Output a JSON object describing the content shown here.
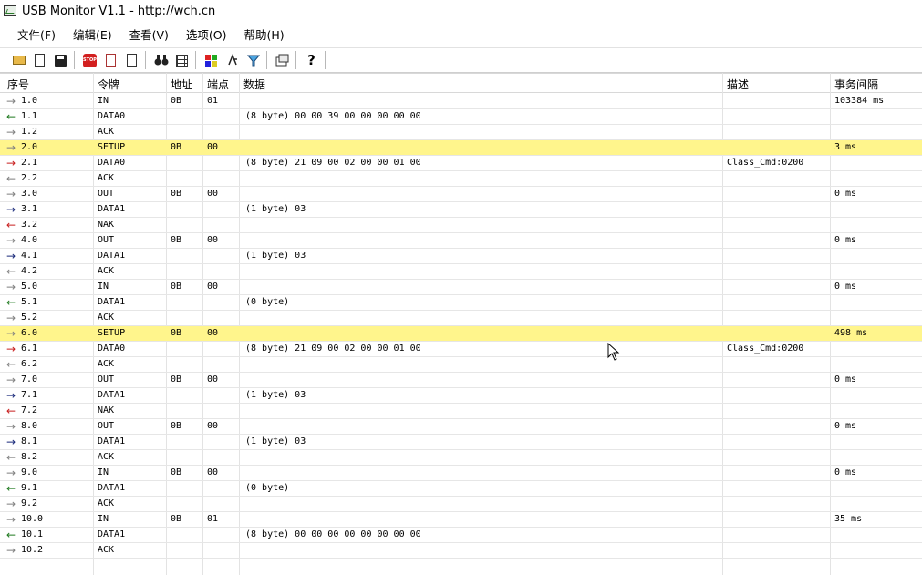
{
  "window": {
    "title": "USB Monitor V1.1 - http://wch.cn"
  },
  "menu": [
    "文件(F)",
    "编辑(E)",
    "查看(V)",
    "选项(O)",
    "帮助(H)"
  ],
  "toolbar": {
    "groups": [
      [
        "open-folder-icon",
        "export-icon",
        "save-icon"
      ],
      [
        "stop-icon",
        "filter-icon",
        "checklist-icon"
      ],
      [
        "binoculars-icon",
        "grid-icon"
      ],
      [
        "colors-icon",
        "pin-icon",
        "funnel-icon"
      ],
      [
        "properties-icon"
      ],
      [
        "help-icon"
      ]
    ],
    "stop_label": "STOP"
  },
  "colors": {
    "arrow_gray": "#808080",
    "arrow_green": "#1f7a1f",
    "arrow_red": "#c81e1e",
    "arrow_navy": "#1a2a7a",
    "highlight": "#fff58c"
  },
  "columns": [
    "序号",
    "令牌",
    "地址",
    "端点",
    "数据",
    "描述",
    "事务间隔"
  ],
  "rows": [
    {
      "seq": "1.0",
      "token": "IN",
      "addr": "0B",
      "ep": "01",
      "data": "",
      "desc": "",
      "interval": "103384 ms",
      "arrow": "→",
      "arrow_color": "#808080",
      "hl": false
    },
    {
      "seq": "1.1",
      "token": "DATA0",
      "addr": "",
      "ep": "",
      "data": "(8 byte) 00 00 39 00 00 00 00 00",
      "desc": "",
      "interval": "",
      "arrow": "←",
      "arrow_color": "#1f7a1f",
      "hl": false
    },
    {
      "seq": "1.2",
      "token": "ACK",
      "addr": "",
      "ep": "",
      "data": "",
      "desc": "",
      "interval": "",
      "arrow": "→",
      "arrow_color": "#808080",
      "hl": false
    },
    {
      "seq": "2.0",
      "token": "SETUP",
      "addr": "0B",
      "ep": "00",
      "data": "",
      "desc": "",
      "interval": "3 ms",
      "arrow": "→",
      "arrow_color": "#808080",
      "hl": true
    },
    {
      "seq": "2.1",
      "token": "DATA0",
      "addr": "",
      "ep": "",
      "data": "(8 byte) 21 09 00 02 00 00 01 00",
      "desc": "Class_Cmd:0200",
      "interval": "",
      "arrow": "→",
      "arrow_color": "#c81e1e",
      "hl": false
    },
    {
      "seq": "2.2",
      "token": "ACK",
      "addr": "",
      "ep": "",
      "data": "",
      "desc": "",
      "interval": "",
      "arrow": "←",
      "arrow_color": "#808080",
      "hl": false
    },
    {
      "seq": "3.0",
      "token": "OUT",
      "addr": "0B",
      "ep": "00",
      "data": "",
      "desc": "",
      "interval": "0 ms",
      "arrow": "→",
      "arrow_color": "#808080",
      "hl": false
    },
    {
      "seq": "3.1",
      "token": "DATA1",
      "addr": "",
      "ep": "",
      "data": "(1 byte) 03",
      "desc": "",
      "interval": "",
      "arrow": "→",
      "arrow_color": "#1a2a7a",
      "hl": false
    },
    {
      "seq": "3.2",
      "token": "NAK",
      "addr": "",
      "ep": "",
      "data": "",
      "desc": "",
      "interval": "",
      "arrow": "←",
      "arrow_color": "#c81e1e",
      "hl": false
    },
    {
      "seq": "4.0",
      "token": "OUT",
      "addr": "0B",
      "ep": "00",
      "data": "",
      "desc": "",
      "interval": "0 ms",
      "arrow": "→",
      "arrow_color": "#808080",
      "hl": false
    },
    {
      "seq": "4.1",
      "token": "DATA1",
      "addr": "",
      "ep": "",
      "data": "(1 byte) 03",
      "desc": "",
      "interval": "",
      "arrow": "→",
      "arrow_color": "#1a2a7a",
      "hl": false
    },
    {
      "seq": "4.2",
      "token": "ACK",
      "addr": "",
      "ep": "",
      "data": "",
      "desc": "",
      "interval": "",
      "arrow": "←",
      "arrow_color": "#808080",
      "hl": false
    },
    {
      "seq": "5.0",
      "token": "IN",
      "addr": "0B",
      "ep": "00",
      "data": "",
      "desc": "",
      "interval": "0 ms",
      "arrow": "→",
      "arrow_color": "#808080",
      "hl": false
    },
    {
      "seq": "5.1",
      "token": "DATA1",
      "addr": "",
      "ep": "",
      "data": "(0 byte)",
      "desc": "",
      "interval": "",
      "arrow": "←",
      "arrow_color": "#1f7a1f",
      "hl": false
    },
    {
      "seq": "5.2",
      "token": "ACK",
      "addr": "",
      "ep": "",
      "data": "",
      "desc": "",
      "interval": "",
      "arrow": "→",
      "arrow_color": "#808080",
      "hl": false
    },
    {
      "seq": "6.0",
      "token": "SETUP",
      "addr": "0B",
      "ep": "00",
      "data": "",
      "desc": "",
      "interval": "498 ms",
      "arrow": "→",
      "arrow_color": "#808080",
      "hl": true
    },
    {
      "seq": "6.1",
      "token": "DATA0",
      "addr": "",
      "ep": "",
      "data": "(8 byte) 21 09 00 02 00 00 01 00",
      "desc": "Class_Cmd:0200",
      "interval": "",
      "arrow": "→",
      "arrow_color": "#c81e1e",
      "hl": false
    },
    {
      "seq": "6.2",
      "token": "ACK",
      "addr": "",
      "ep": "",
      "data": "",
      "desc": "",
      "interval": "",
      "arrow": "←",
      "arrow_color": "#808080",
      "hl": false
    },
    {
      "seq": "7.0",
      "token": "OUT",
      "addr": "0B",
      "ep": "00",
      "data": "",
      "desc": "",
      "interval": "0 ms",
      "arrow": "→",
      "arrow_color": "#808080",
      "hl": false
    },
    {
      "seq": "7.1",
      "token": "DATA1",
      "addr": "",
      "ep": "",
      "data": "(1 byte) 03",
      "desc": "",
      "interval": "",
      "arrow": "→",
      "arrow_color": "#1a2a7a",
      "hl": false
    },
    {
      "seq": "7.2",
      "token": "NAK",
      "addr": "",
      "ep": "",
      "data": "",
      "desc": "",
      "interval": "",
      "arrow": "←",
      "arrow_color": "#c81e1e",
      "hl": false
    },
    {
      "seq": "8.0",
      "token": "OUT",
      "addr": "0B",
      "ep": "00",
      "data": "",
      "desc": "",
      "interval": "0 ms",
      "arrow": "→",
      "arrow_color": "#808080",
      "hl": false
    },
    {
      "seq": "8.1",
      "token": "DATA1",
      "addr": "",
      "ep": "",
      "data": "(1 byte) 03",
      "desc": "",
      "interval": "",
      "arrow": "→",
      "arrow_color": "#1a2a7a",
      "hl": false
    },
    {
      "seq": "8.2",
      "token": "ACK",
      "addr": "",
      "ep": "",
      "data": "",
      "desc": "",
      "interval": "",
      "arrow": "←",
      "arrow_color": "#808080",
      "hl": false
    },
    {
      "seq": "9.0",
      "token": "IN",
      "addr": "0B",
      "ep": "00",
      "data": "",
      "desc": "",
      "interval": "0 ms",
      "arrow": "→",
      "arrow_color": "#808080",
      "hl": false
    },
    {
      "seq": "9.1",
      "token": "DATA1",
      "addr": "",
      "ep": "",
      "data": "(0 byte)",
      "desc": "",
      "interval": "",
      "arrow": "←",
      "arrow_color": "#1f7a1f",
      "hl": false
    },
    {
      "seq": "9.2",
      "token": "ACK",
      "addr": "",
      "ep": "",
      "data": "",
      "desc": "",
      "interval": "",
      "arrow": "→",
      "arrow_color": "#808080",
      "hl": false
    },
    {
      "seq": "10.0",
      "token": "IN",
      "addr": "0B",
      "ep": "01",
      "data": "",
      "desc": "",
      "interval": "35 ms",
      "arrow": "→",
      "arrow_color": "#808080",
      "hl": false
    },
    {
      "seq": "10.1",
      "token": "DATA1",
      "addr": "",
      "ep": "",
      "data": "(8 byte) 00 00 00 00 00 00 00 00",
      "desc": "",
      "interval": "",
      "arrow": "←",
      "arrow_color": "#1f7a1f",
      "hl": false
    },
    {
      "seq": "10.2",
      "token": "ACK",
      "addr": "",
      "ep": "",
      "data": "",
      "desc": "",
      "interval": "",
      "arrow": "→",
      "arrow_color": "#808080",
      "hl": false
    }
  ]
}
